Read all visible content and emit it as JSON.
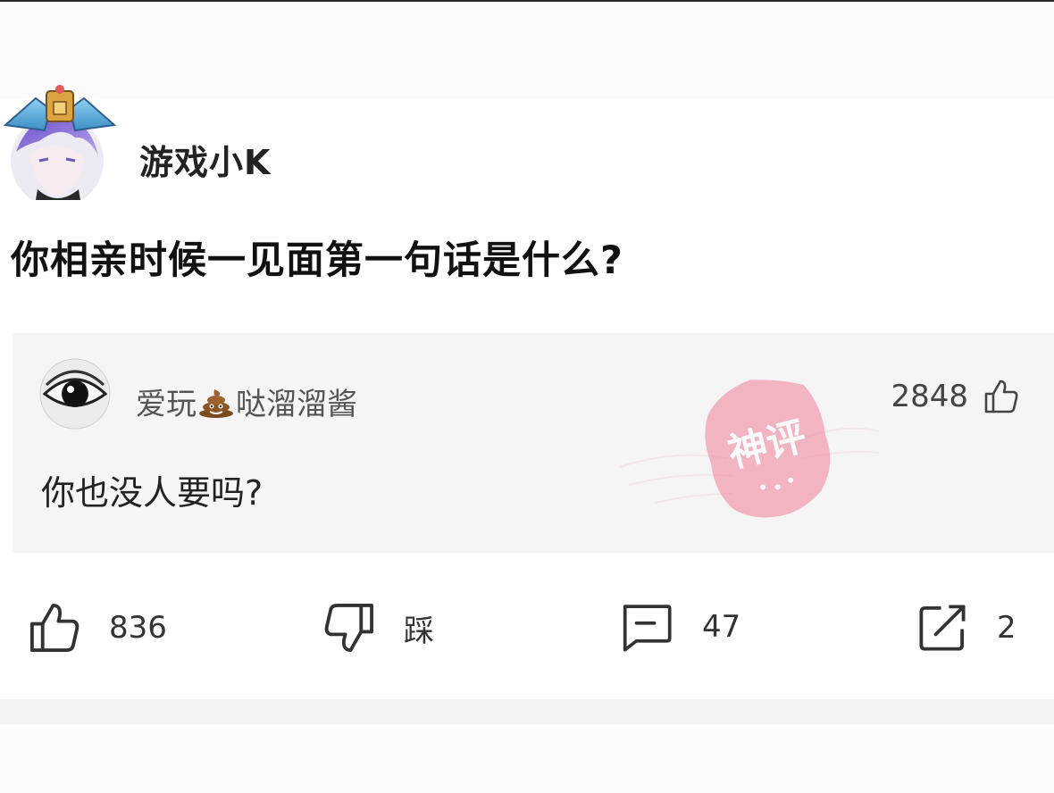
{
  "post": {
    "author": "游戏小K",
    "title": "你相亲时候一见面第一句话是什么?"
  },
  "comment": {
    "user_prefix": "爱玩",
    "user_suffix": "哒溜溜酱",
    "likes": "2848",
    "text": "你也没人要吗?",
    "badge": "神评"
  },
  "actions": {
    "like_count": "836",
    "dislike_label": "踩",
    "comment_count": "47",
    "share_count": "2"
  }
}
